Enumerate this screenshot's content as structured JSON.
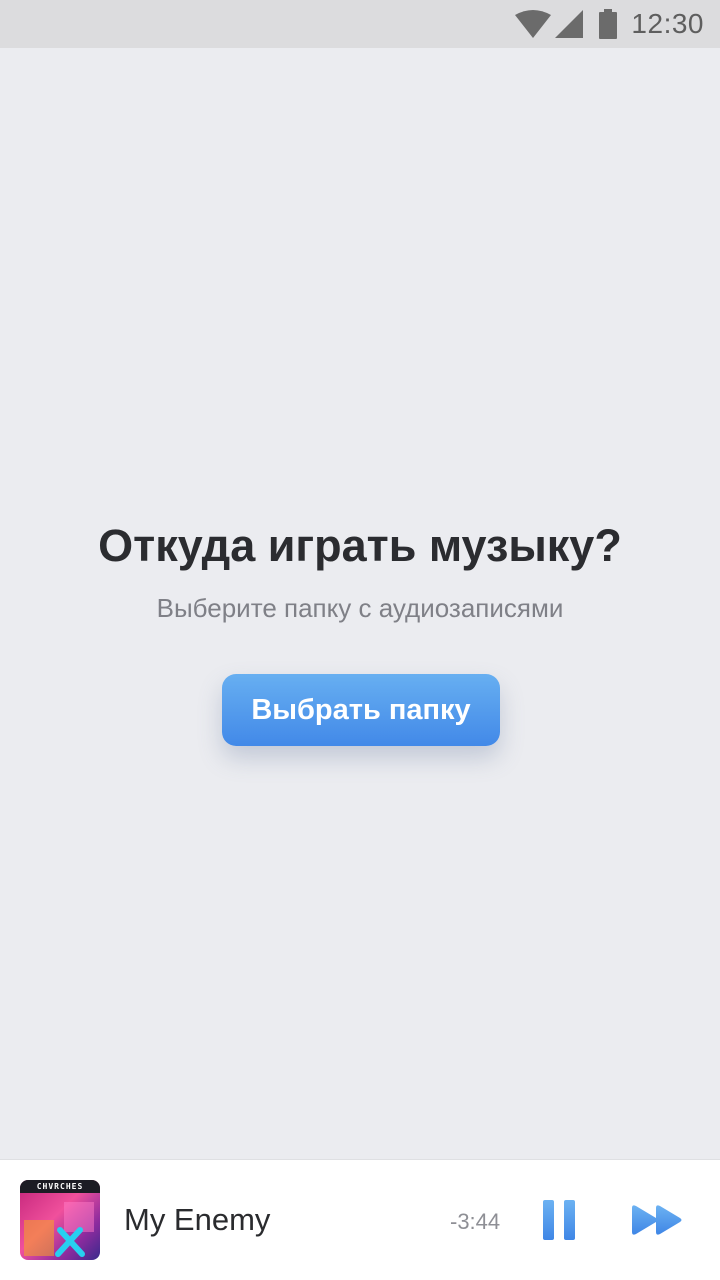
{
  "status_bar": {
    "time": "12:30",
    "icons": [
      "wifi-icon",
      "cell-signal-icon",
      "battery-icon"
    ]
  },
  "empty_state": {
    "title": "Откуда играть музыку?",
    "subtitle": "Выберите папку с аудиозаписями",
    "button_label": "Выбрать папку"
  },
  "player": {
    "album_band_text": "CHVRCHES",
    "track_title": "My Enemy",
    "time_remaining": "-3:44",
    "controls": [
      "pause-icon",
      "fast-forward-icon"
    ]
  },
  "colors": {
    "accent": "#4a90e8",
    "background": "#ebecf0",
    "status_bar": "#dcdcde",
    "heading_text": "#2b2c30",
    "secondary_text": "#7f8087"
  }
}
